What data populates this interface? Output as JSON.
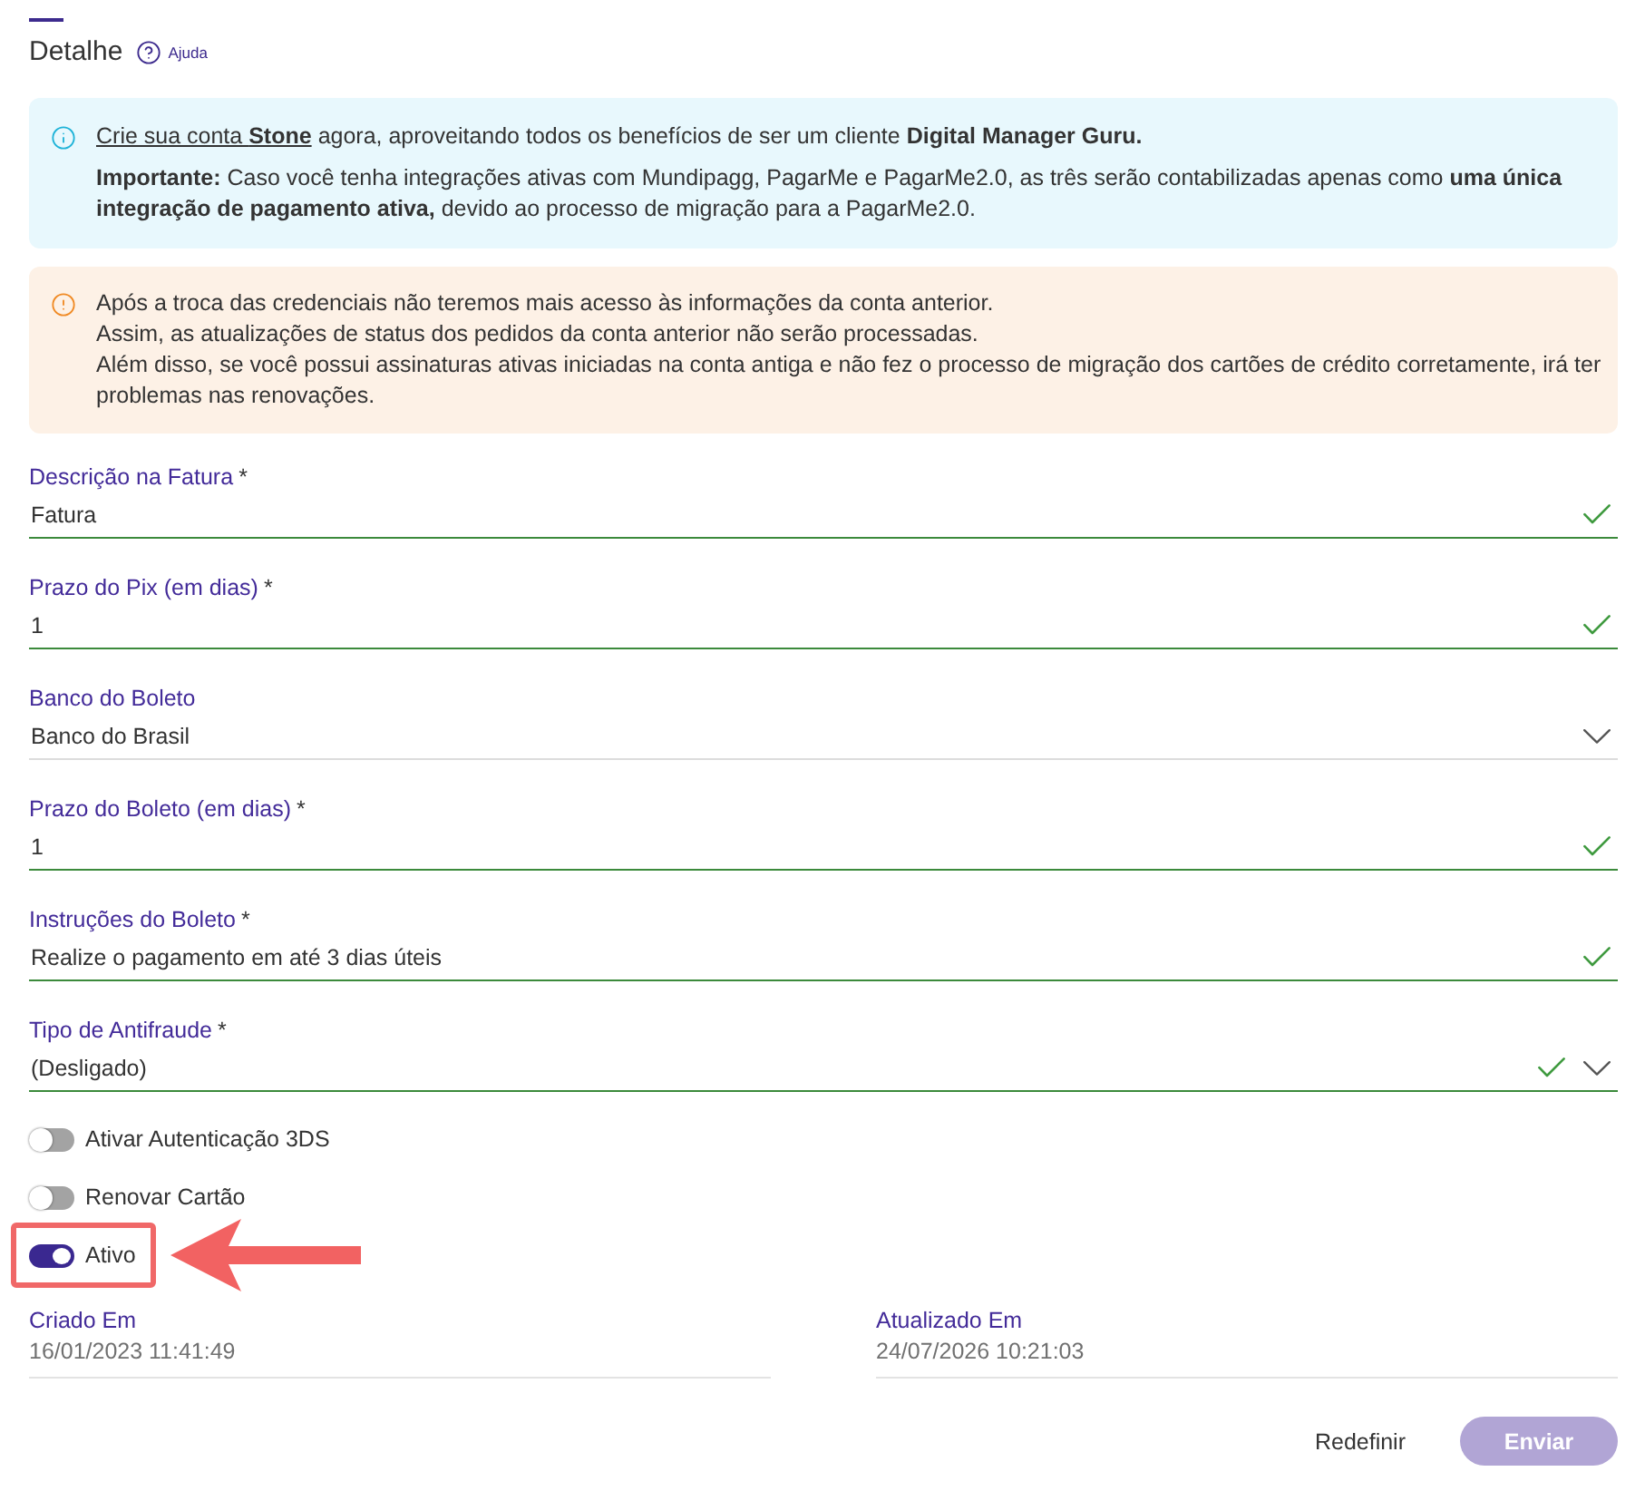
{
  "header": {
    "title": "Detalhe",
    "help_label": "Ajuda"
  },
  "info_banner": {
    "link": "Crie sua conta **Stone**",
    "text": "agora, aproveitando todos os benefícios de ser um cliente **Digital Manager Guru.**",
    "note": "**Importante:** Caso você tenha integrações ativas com Mundipagg, PagarMe e PagarMe2.0, as três serão contabilizadas apenas como **uma única integração de pagamento ativa,** devido ao processo de migração para a PagarMe2.0."
  },
  "warning_banner": {
    "lines": [
      "Após a troca das credenciais não teremos mais acesso às informações da conta anterior.",
      "Assim, as atualizações de status dos pedidos da conta anterior não serão processadas.",
      "Além disso, se você possui assinaturas ativas iniciadas na conta antiga e não fez o processo de migração dos cartões de crédito corretamente, irá ter problemas nas renovações."
    ]
  },
  "fields": [
    {
      "label": "Descrição na Fatura",
      "required_mark": "*",
      "value": "Fatura",
      "kind": "text",
      "valid": true
    },
    {
      "label": "Prazo do Pix (em dias)",
      "required_mark": "*",
      "value": "1",
      "kind": "text",
      "valid": true
    },
    {
      "label": "Banco do Boleto",
      "value": "Banco do Brasil",
      "kind": "select",
      "valid": false
    },
    {
      "label": "Prazo do Boleto (em dias)",
      "required_mark": "*",
      "value": "1",
      "kind": "text",
      "valid": true
    },
    {
      "label": "Instruções do Boleto",
      "required_mark": "*",
      "value": "Realize o pagamento em até 3 dias úteis",
      "kind": "text",
      "valid": true
    },
    {
      "label": "Tipo de Antifraude",
      "required_mark": "*",
      "value": "(Desligado)",
      "kind": "select",
      "valid": true
    }
  ],
  "toggles": [
    {
      "label": "Ativar Autenticação 3DS",
      "on": false,
      "highlighted": false
    },
    {
      "label": "Renovar Cartão",
      "on": false,
      "highlighted": false
    },
    {
      "label": "Ativo",
      "on": true,
      "highlighted": true
    }
  ],
  "meta": [
    {
      "label": "Criado Em",
      "value": "16/01/2023 11:41:49"
    },
    {
      "label": "Atualizado Em",
      "value": "24/07/2026 10:21:03"
    }
  ],
  "actions": {
    "reset": {
      "label": "Redefinir"
    },
    "submit": {
      "label": "Enviar",
      "disabled": true
    }
  }
}
